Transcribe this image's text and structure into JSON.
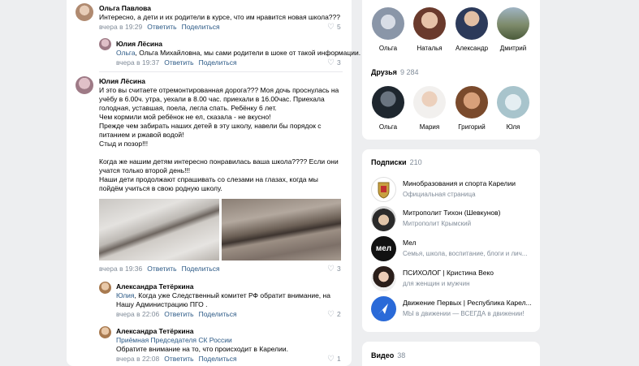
{
  "comments": [
    {
      "author": "Ольга Павлова",
      "lines": [
        "Интересно, а дети и их родители в курсе, что им нравится новая школа???"
      ],
      "time": "вчера в 19:29",
      "reply": "Ответить",
      "share": "Поделиться",
      "likes": "5"
    },
    {
      "author": "Юлия Лёсина",
      "reply_to": "Ольга",
      "lines_rest": [
        ", Ольга Михайловна, мы сами родители в шоке от такой информации."
      ],
      "time": "вчера в 19:37",
      "reply": "Ответить",
      "share": "Поделиться",
      "likes": "3"
    },
    {
      "author": "Юлия Лёсина",
      "lines": [
        "И это вы считаете отремонтированная дорога??? Моя дочь проснулась на",
        "учёбу в 6.00ч. утра, уехали в 8.00 час. приехали в 16.00час. Приехала",
        "голодная, уставшая, поела, легла спать. Ребёнку 6 лет.",
        "Чем кормили мой ребёнок не ел, сказала - не вкусно!",
        "Прежде чем забирать наших детей в эту школу, навели бы порядок с",
        "питанием и ржавой водой!",
        "Стыд и позор!!!",
        "",
        "Когда же нашим детям интересно понравилась ваша школа???? Если они",
        "учатся только второй день!!!",
        "Наши дети продолжают спрашивать со слезами на глазах, когда мы",
        "пойдём учиться в свою родную школу."
      ],
      "time": "вчера в 19:36",
      "reply": "Ответить",
      "share": "Поделиться",
      "likes": "3"
    },
    {
      "author": "Александра Тетёркина",
      "reply_to": "Юлия",
      "lines_rest": [
        ", Когда уже Следственный комитет РФ обратит внимание, на",
        "Нашу Администрацию ПГО ."
      ],
      "time": "вчера в 22:06",
      "reply": "Ответить",
      "share": "Поделиться",
      "likes": "2"
    },
    {
      "author": "Александра Тетёркина",
      "reply_to": "Приёмная Председателя СК России",
      "lines": [
        "Обратите внимание на то, что происходит в Карелии."
      ],
      "time": "вчера в 22:08",
      "reply": "Ответить",
      "share": "Поделиться",
      "likes": "1"
    }
  ],
  "top_friends": [
    "Ольга",
    "Наталья",
    "Александр",
    "Дмитрий"
  ],
  "friends": {
    "title": "Друзья",
    "count": "9 284",
    "names": [
      "Ольга",
      "Мария",
      "Григорий",
      "Юля"
    ]
  },
  "subscriptions": {
    "title": "Подписки",
    "count": "210",
    "items": [
      {
        "name": "Минобразования и спорта Карелии",
        "desc": "Официальная страница"
      },
      {
        "name": "Митрополит Тихон (Шевкунов)",
        "desc": "Митрополит Крымский"
      },
      {
        "name": "Мел",
        "desc": "Семья, школа, воспитание, блоги и лич..."
      },
      {
        "name": "ПСИХОЛОГ | Кристина Веко",
        "desc": "для женщин и мужчин"
      },
      {
        "name": "Движение Первых | Республика Карел...",
        "desc": "МЫ в движении — ВСЕГДА в движении!"
      }
    ]
  },
  "videos": {
    "title": "Видео",
    "count": "38"
  },
  "icons": {
    "like": "heart-icon"
  },
  "colors": {
    "link": "#2a5885",
    "meta": "#818c99",
    "background": "#edeef0"
  }
}
